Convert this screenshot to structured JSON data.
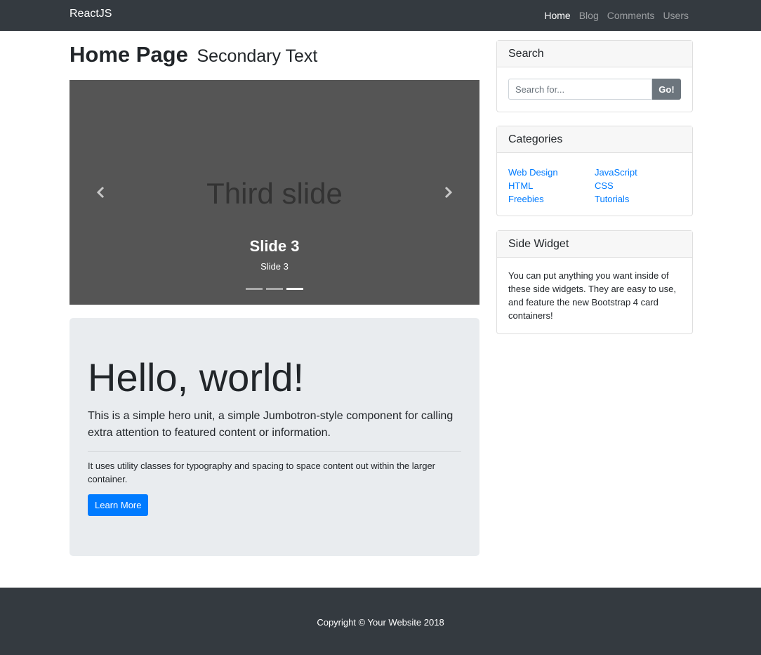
{
  "navbar": {
    "brand": "ReactJS",
    "links": [
      "Home",
      "Blog",
      "Comments",
      "Users"
    ],
    "active": "Home"
  },
  "header": {
    "title": "Home Page",
    "subtitle": "Secondary Text"
  },
  "carousel": {
    "slide_text": "Third slide",
    "caption_title": "Slide 3",
    "caption_text": "Slide 3",
    "slide_count": 3,
    "active_index": 2,
    "icons": [
      "chevron-left-icon",
      "chevron-right-icon"
    ]
  },
  "jumbotron": {
    "heading": "Hello, world!",
    "lead": "This is a simple hero unit, a simple Jumbotron-style component for calling extra attention to featured content or information.",
    "text": "It uses utility classes for typography and spacing to space content out within the larger container.",
    "button": "Learn More"
  },
  "search": {
    "title": "Search",
    "placeholder": "Search for...",
    "value": "",
    "button": "Go!"
  },
  "categories": {
    "title": "Categories",
    "left": [
      "Web Design",
      "HTML",
      "Freebies"
    ],
    "right": [
      "JavaScript",
      "CSS",
      "Tutorials"
    ]
  },
  "widget": {
    "title": "Side Widget",
    "text": "You can put anything you want inside of these side widgets. They are easy to use, and feature the new Bootstrap 4 card containers!"
  },
  "footer": {
    "text": "Copyright © Your Website 2018"
  },
  "colors": {
    "navbar": "#343a40",
    "primary": "#007bff",
    "secondary": "#6c757d",
    "jumbotron": "#e9ecef",
    "carousel": "#555555"
  }
}
